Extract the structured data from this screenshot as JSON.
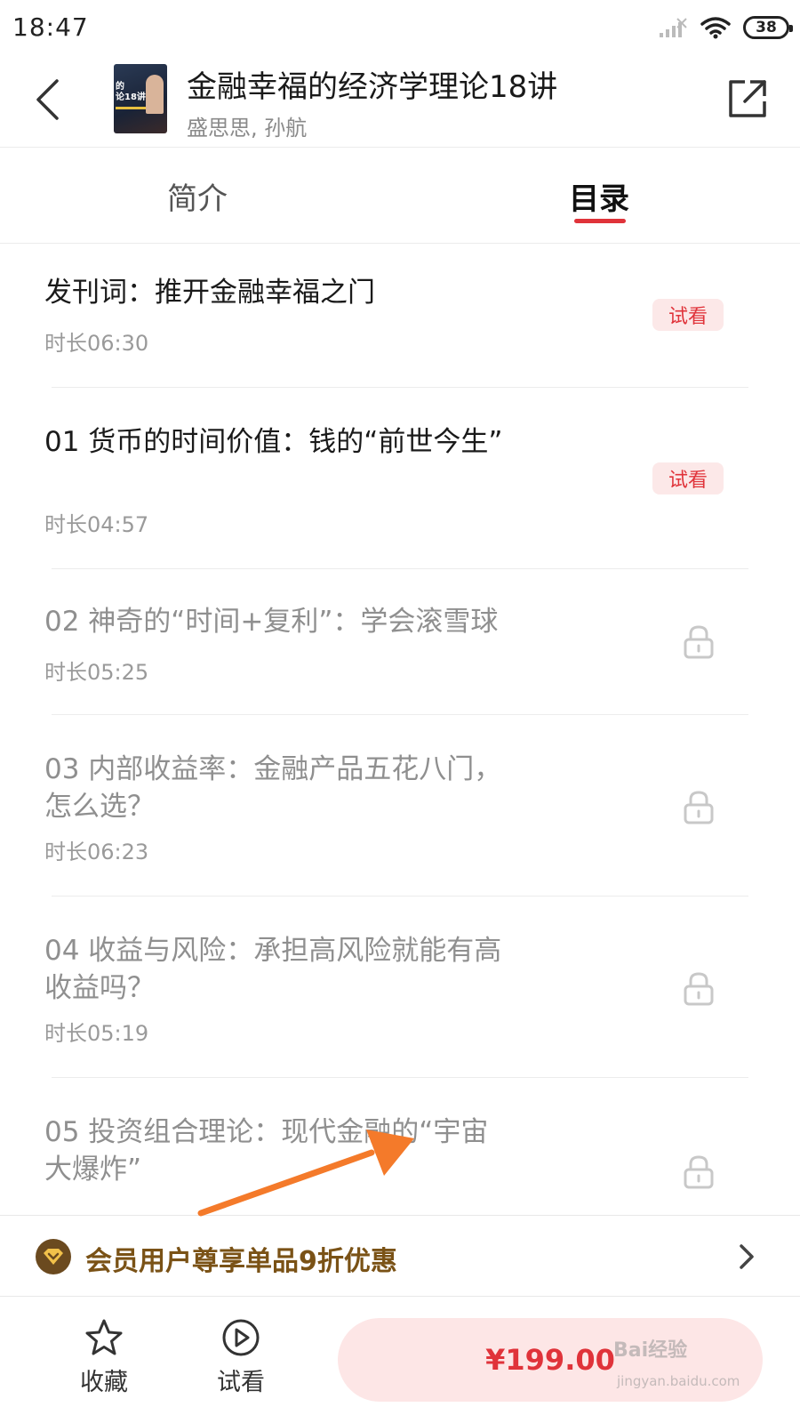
{
  "status_bar": {
    "time": "18:47",
    "battery": "38",
    "signal_icon": "signal-bars-icon",
    "wifi_icon": "wifi-icon"
  },
  "header": {
    "title": "金融幸福的经济学理论18讲",
    "authors": "盛思思, 孙航",
    "cover_text": "的\n论18讲",
    "back_icon": "chevron-left-icon",
    "share_icon": "share-external-icon"
  },
  "tabs": {
    "intro": "简介",
    "catalog": "目录",
    "active": "catalog",
    "accent_color": "#e0333a"
  },
  "lessons": [
    {
      "title": "发刊词：推开金融幸福之门",
      "duration": "时长06:30",
      "badge": "试看",
      "locked": false
    },
    {
      "title": "01 货币的时间价值：钱的“前世今生”",
      "duration": "时长04:57",
      "badge": "试看",
      "locked": false
    },
    {
      "title": "02 神奇的“时间+复利”：学会滚雪球",
      "duration": "时长05:25",
      "badge": "",
      "locked": true
    },
    {
      "title": "03 内部收益率：金融产品五花八门，怎么选？",
      "duration": "时长06:23",
      "badge": "",
      "locked": true
    },
    {
      "title": "04 收益与风险：承担高风险就能有高收益吗？",
      "duration": "时长05:19",
      "badge": "",
      "locked": true
    },
    {
      "title": "05 投资组合理论：现代金融的“宇宙大爆炸”",
      "duration": "",
      "badge": "",
      "locked": true
    }
  ],
  "member_bar": {
    "text": "会员用户尊享单品9折优惠",
    "icon": "vip-diamond-icon",
    "color": "#7a5216"
  },
  "bottom_bar": {
    "favorite_label": "收藏",
    "trial_label": "试看",
    "price": "¥199.00",
    "favorite_icon": "star-icon",
    "trial_icon": "play-circle-icon"
  },
  "watermark": {
    "brand": "Bai经验",
    "url": "jingyan.baidu.com"
  }
}
